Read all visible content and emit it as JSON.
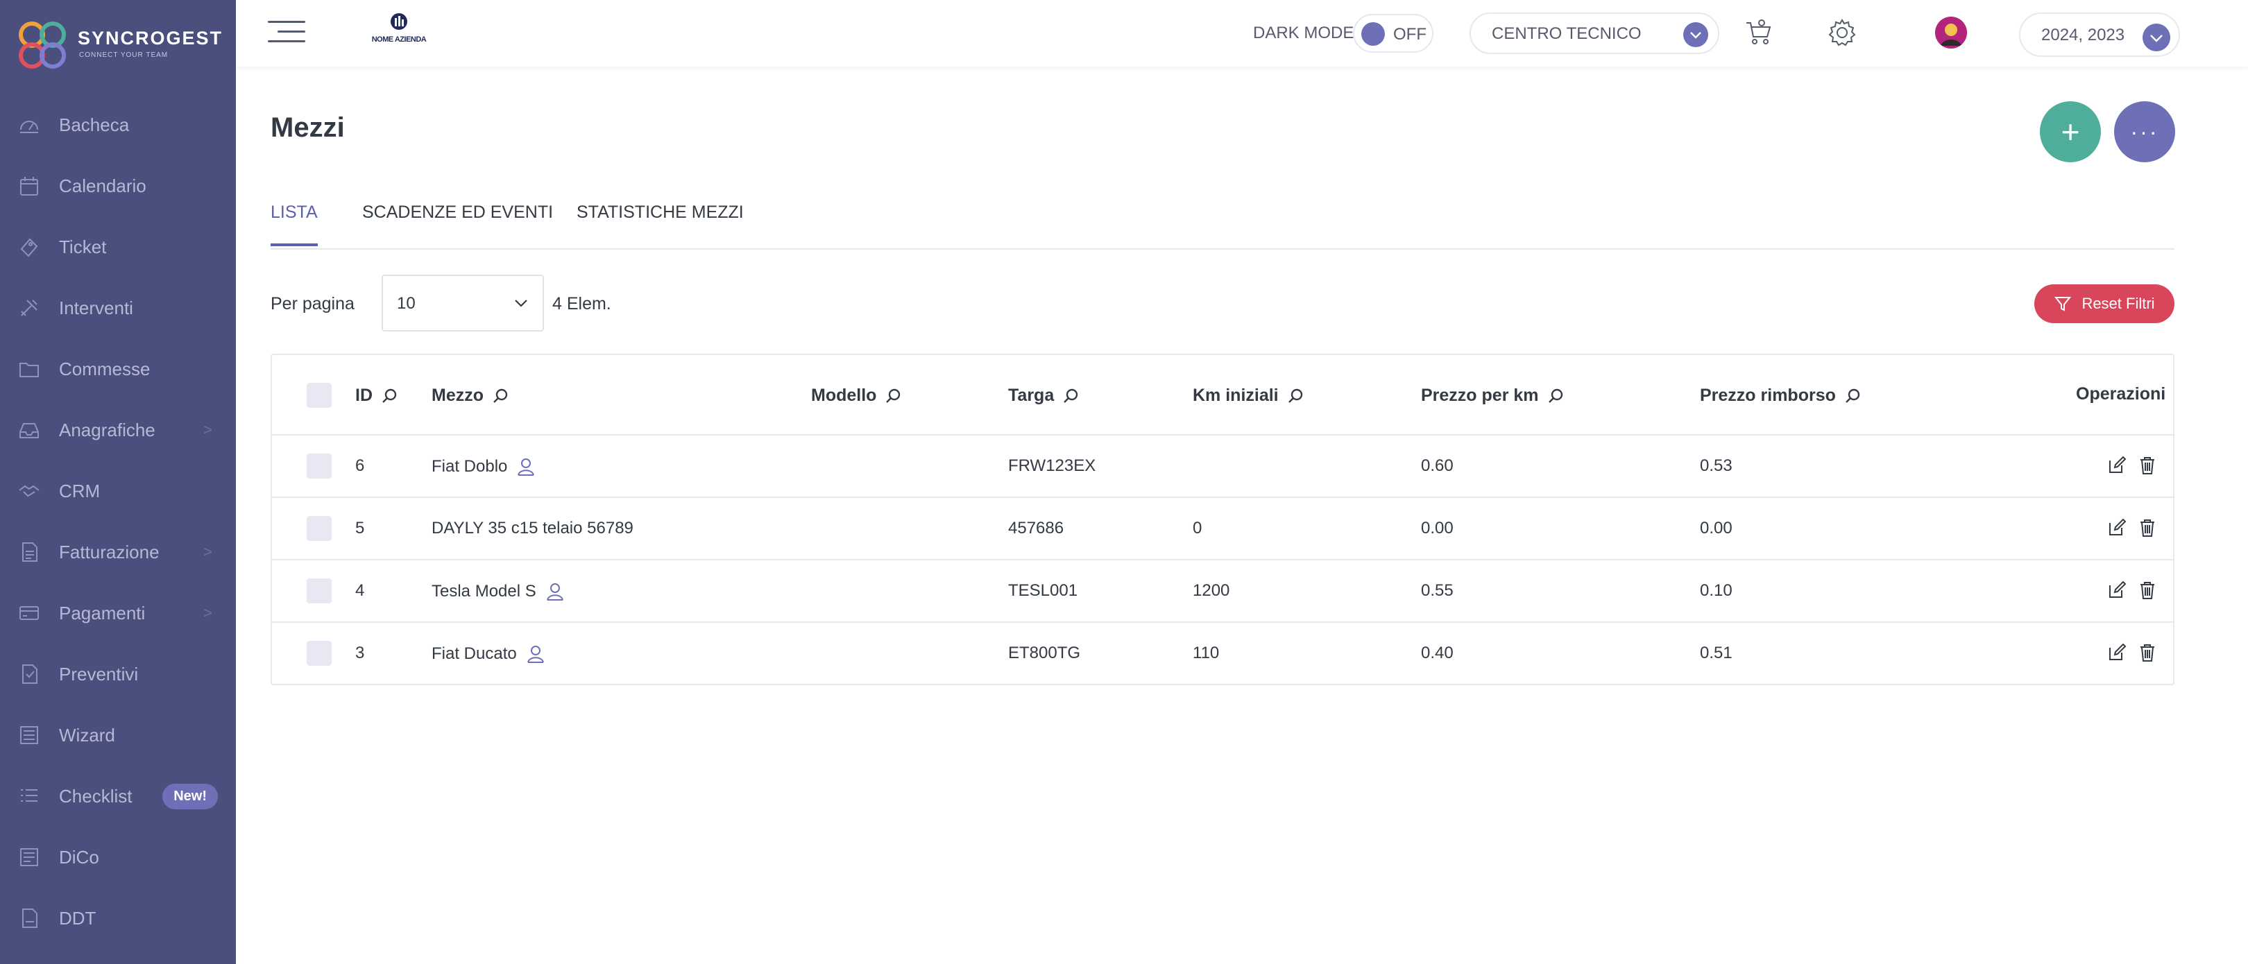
{
  "app": {
    "name": "SYNCROGEST",
    "tagline": "CONNECT YOUR TEAM",
    "company_logo_text": "NOME AZIENDA"
  },
  "sidebar": {
    "items": [
      {
        "label": "Bacheca",
        "icon": "dashboard-icon",
        "chevron": false
      },
      {
        "label": "Calendario",
        "icon": "calendar-icon",
        "chevron": false
      },
      {
        "label": "Ticket",
        "icon": "ticket-icon",
        "chevron": false
      },
      {
        "label": "Interventi",
        "icon": "tools-icon",
        "chevron": false
      },
      {
        "label": "Commesse",
        "icon": "folder-icon",
        "chevron": false
      },
      {
        "label": "Anagrafiche",
        "icon": "inbox-icon",
        "chevron": true
      },
      {
        "label": "CRM",
        "icon": "handshake-icon",
        "chevron": false
      },
      {
        "label": "Fatturazione",
        "icon": "invoice-icon",
        "chevron": true
      },
      {
        "label": "Pagamenti",
        "icon": "payment-icon",
        "chevron": true
      },
      {
        "label": "Preventivi",
        "icon": "quote-icon",
        "chevron": false
      },
      {
        "label": "Wizard",
        "icon": "wizard-icon",
        "chevron": false
      },
      {
        "label": "Checklist",
        "icon": "checklist-icon",
        "chevron": false,
        "badge": "New!"
      },
      {
        "label": "DiCo",
        "icon": "dico-icon",
        "chevron": false
      },
      {
        "label": "DDT",
        "icon": "ddt-icon",
        "chevron": false
      }
    ],
    "chevron_glyph": ">"
  },
  "topbar": {
    "dark_mode_label": "DARK MODE",
    "dark_mode_state": "OFF",
    "department": "CENTRO TECNICO",
    "years": "2024, 2023"
  },
  "page": {
    "title": "Mezzi",
    "tabs": [
      "LISTA",
      "SCADENZE ED EVENTI",
      "STATISTICHE MEZZI"
    ],
    "active_tab": 0,
    "per_page_label": "Per pagina",
    "per_page_value": "10",
    "element_count": "4 Elem.",
    "reset_filters_label": "Reset Filtri"
  },
  "table": {
    "columns": [
      "ID",
      "Mezzo",
      "Modello",
      "Targa",
      "Km iniziali",
      "Prezzo per km",
      "Prezzo rimborso",
      "Operazioni"
    ],
    "rows": [
      {
        "id": "6",
        "mezzo": "Fiat Doblo",
        "assigned": true,
        "modello": "",
        "targa": "FRW123EX",
        "km": "",
        "prezzo_km": "0.60",
        "rimborso": "0.53"
      },
      {
        "id": "5",
        "mezzo": "DAYLY 35 c15 telaio 56789",
        "assigned": false,
        "modello": "",
        "targa": "457686",
        "km": "0",
        "prezzo_km": "0.00",
        "rimborso": "0.00"
      },
      {
        "id": "4",
        "mezzo": "Tesla Model S",
        "assigned": true,
        "modello": "",
        "targa": "TESL001",
        "km": "1200",
        "prezzo_km": "0.55",
        "rimborso": "0.10"
      },
      {
        "id": "3",
        "mezzo": "Fiat Ducato",
        "assigned": true,
        "modello": "",
        "targa": "ET800TG",
        "km": "110",
        "prezzo_km": "0.40",
        "rimborso": "0.51"
      }
    ]
  },
  "colors": {
    "sidebar_bg": "#4a4f7e",
    "accent": "#6d6fb7",
    "add_button": "#4fae9b",
    "reset_button": "#d9455a"
  }
}
